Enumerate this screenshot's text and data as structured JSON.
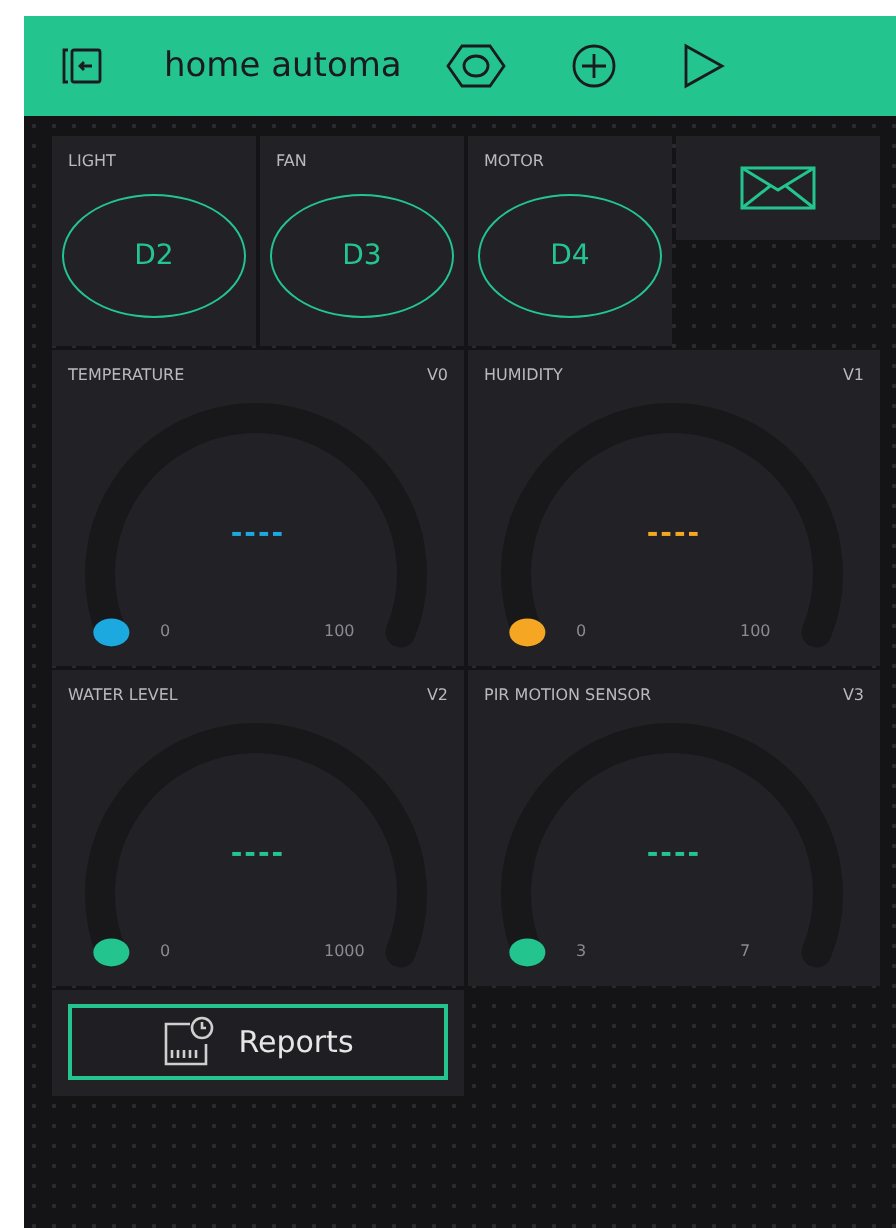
{
  "header": {
    "title": "home automa"
  },
  "buttons": [
    {
      "label": "LIGHT",
      "pin": "D2"
    },
    {
      "label": "FAN",
      "pin": "D3"
    },
    {
      "label": "MOTOR",
      "pin": "D4"
    }
  ],
  "gauges": [
    {
      "label": "TEMPERATURE",
      "pin": "V0",
      "value": "----",
      "min": "0",
      "max": "100",
      "color": "#1ba9e0"
    },
    {
      "label": "HUMIDITY",
      "pin": "V1",
      "value": "----",
      "min": "0",
      "max": "100",
      "color": "#f5a623"
    },
    {
      "label": "WATER LEVEL",
      "pin": "V2",
      "value": "----",
      "min": "0",
      "max": "1000",
      "color": "#23c48e"
    },
    {
      "label": "PIR MOTION SENSOR",
      "pin": "V3",
      "value": "----",
      "min": "3",
      "max": "7",
      "color": "#23c48e"
    }
  ],
  "reports": {
    "label": "Reports"
  }
}
